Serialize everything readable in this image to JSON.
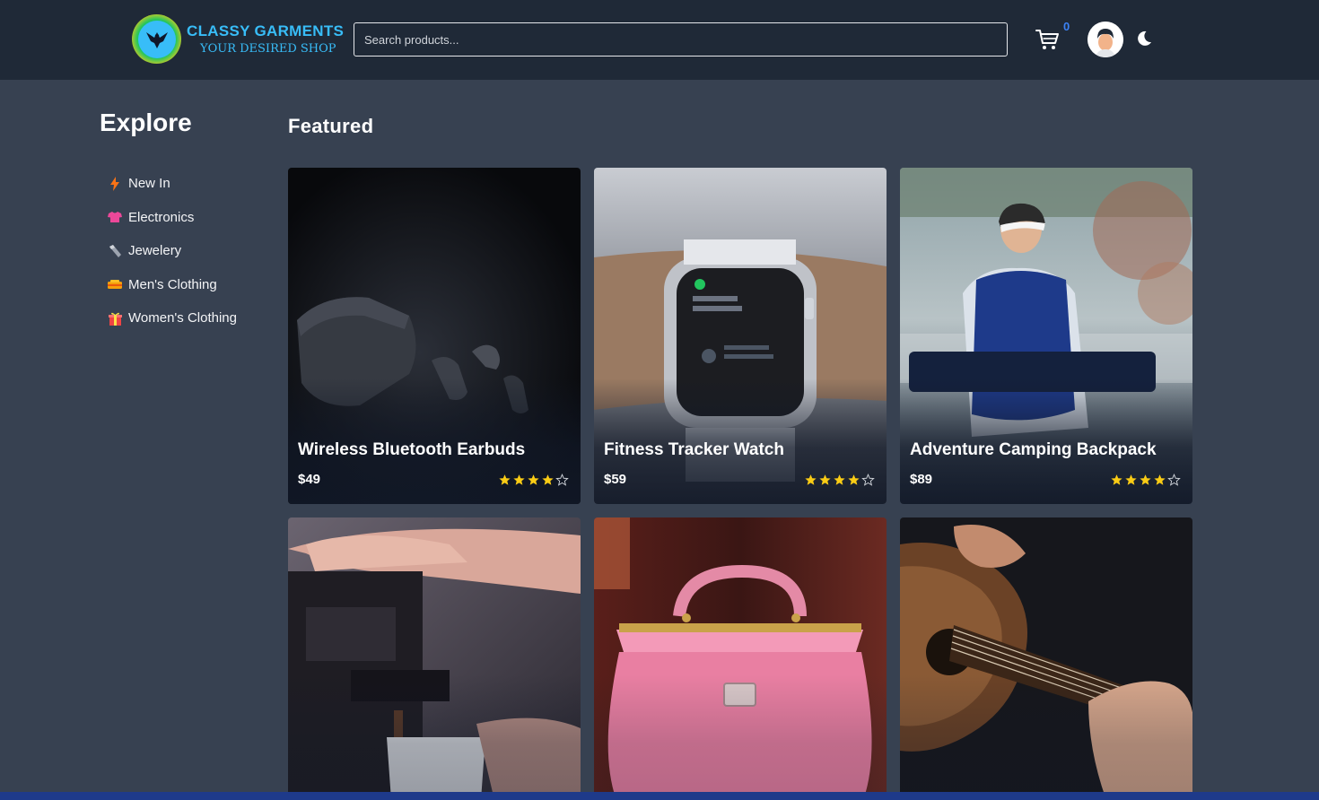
{
  "header": {
    "logo_title": "CLASSY GARMENTS",
    "logo_subtitle": "YOUR DESIRED SHOP",
    "search_placeholder": "Search products...",
    "cart_count": "0",
    "cart_icon": "cart-icon",
    "avatar_icon": "avatar",
    "theme_icon": "moon-icon",
    "accent_color": "#38bdf8"
  },
  "sidebar": {
    "title": "Explore",
    "items": [
      {
        "label": "New In",
        "icon": "lightning-icon",
        "color": "#f97316"
      },
      {
        "label": "Electronics",
        "icon": "tshirt-icon",
        "color": "#ec4899"
      },
      {
        "label": "Jewelery",
        "icon": "ring-icon",
        "color": "#9ca3af"
      },
      {
        "label": "Men's Clothing",
        "icon": "clothing-icon",
        "color": "#f59e0b"
      },
      {
        "label": "Women's Clothing",
        "icon": "gift-icon",
        "color": "#ef4444"
      }
    ]
  },
  "main": {
    "title": "Featured",
    "products": [
      {
        "title": "Wireless Bluetooth Earbuds",
        "price": "$49",
        "rating": 4,
        "rating_max": 5
      },
      {
        "title": "Fitness Tracker Watch",
        "price": "$59",
        "rating": 4,
        "rating_max": 5
      },
      {
        "title": "Adventure Camping Backpack",
        "price": "$89",
        "rating": 4,
        "rating_max": 5
      },
      {
        "title": "",
        "price": "",
        "rating": 0,
        "rating_max": 5
      },
      {
        "title": "",
        "price": "",
        "rating": 0,
        "rating_max": 5
      },
      {
        "title": "",
        "price": "",
        "rating": 0,
        "rating_max": 5
      }
    ]
  },
  "colors": {
    "header_bg": "#1f2937",
    "page_bg": "#374151",
    "star": "#facc15"
  }
}
